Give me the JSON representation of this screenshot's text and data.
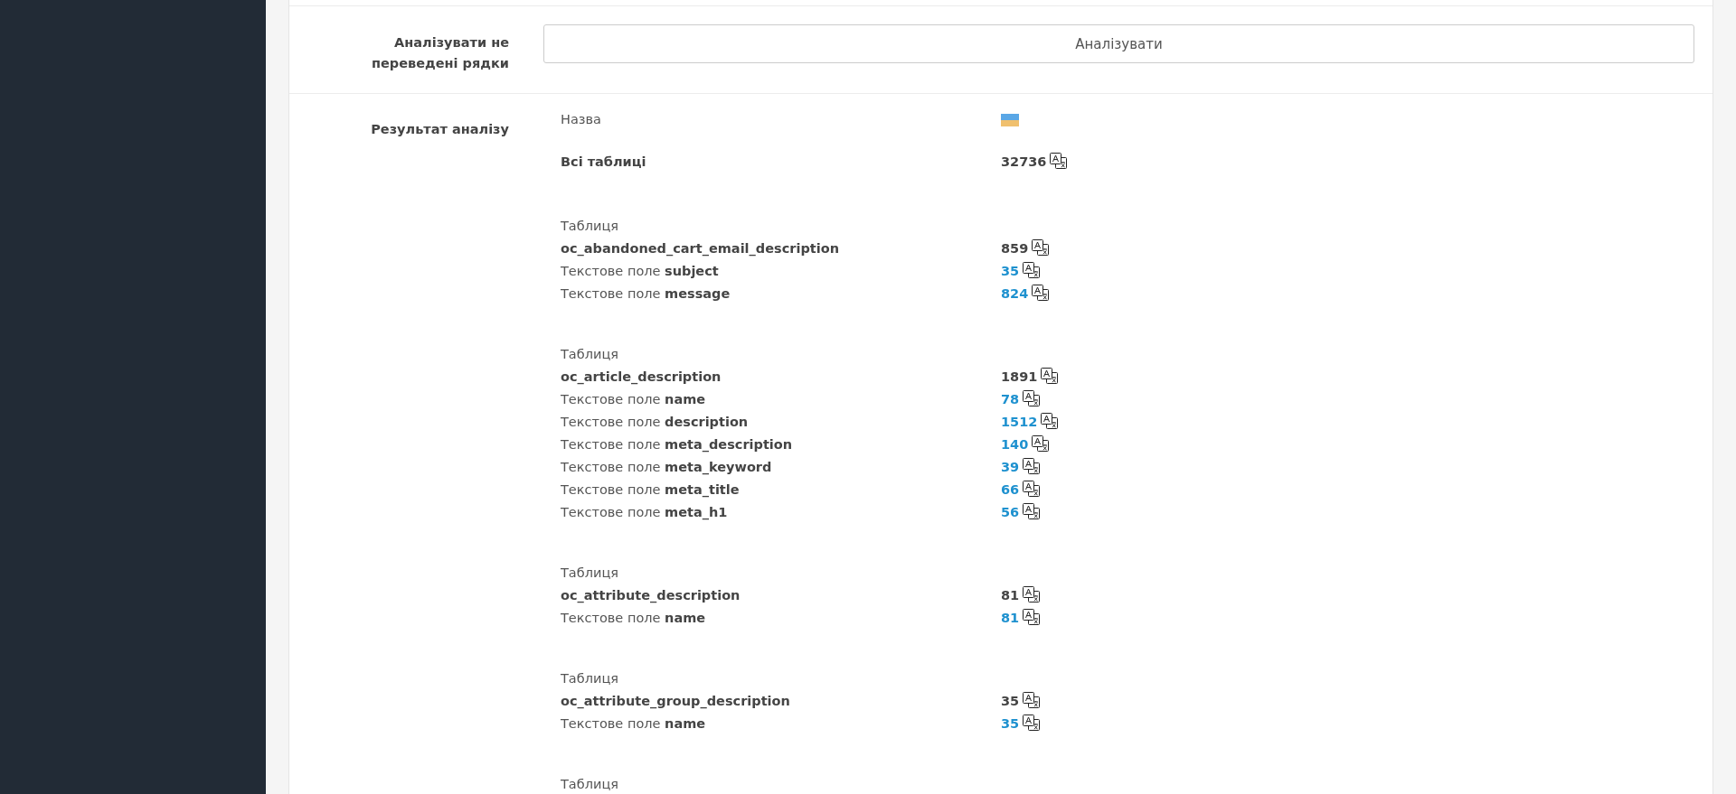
{
  "analyze_row": {
    "label": "Аналізувати не переведені рядки",
    "button": "Аналізувати"
  },
  "result": {
    "label": "Результат аналізу",
    "header": {
      "name": "Назва"
    },
    "total": {
      "label": "Всі таблиці",
      "count": "32736"
    },
    "tables": [
      {
        "caption": "Таблиця",
        "name": "oc_abandoned_cart_email_description",
        "count": "859",
        "fields": [
          {
            "label": "Текстове поле **subject**",
            "count": "35"
          },
          {
            "label": "Текстове поле **message**",
            "count": "824"
          }
        ]
      },
      {
        "caption": "Таблиця",
        "name": "oc_article_description",
        "count": "1891",
        "fields": [
          {
            "label": "Текстове поле **name**",
            "count": "78"
          },
          {
            "label": "Текстове поле **description**",
            "count": "1512"
          },
          {
            "label": "Текстове поле **meta_description**",
            "count": "140"
          },
          {
            "label": "Текстове поле **meta_keyword**",
            "count": "39"
          },
          {
            "label": "Текстове поле **meta_title**",
            "count": "66"
          },
          {
            "label": "Текстове поле **meta_h1**",
            "count": "56"
          }
        ]
      },
      {
        "caption": "Таблиця",
        "name": "oc_attribute_description",
        "count": "81",
        "fields": [
          {
            "label": "Текстове поле **name**",
            "count": "81"
          }
        ]
      },
      {
        "caption": "Таблиця",
        "name": "oc_attribute_group_description",
        "count": "35",
        "fields": [
          {
            "label": "Текстове поле **name**",
            "count": "35"
          }
        ]
      },
      {
        "caption": "Таблиця"
      }
    ]
  }
}
